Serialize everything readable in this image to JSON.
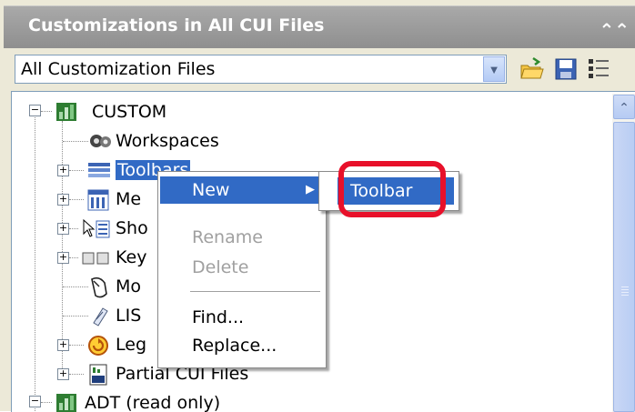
{
  "panel": {
    "title": "Customizations in All CUI Files",
    "collapse_glyph": "«"
  },
  "file_selector": {
    "value": "All Customization Files",
    "dropdown_glyph": "∨"
  },
  "toolbar_icons": [
    "open-file-icon",
    "save-icon",
    "list-view-icon"
  ],
  "tree": {
    "root": "CUSTOM",
    "items": [
      {
        "label": "Workspaces",
        "icon": "gears-icon"
      },
      {
        "label": "Toolbars",
        "icon": "toolbars-icon"
      },
      {
        "label": "Me",
        "icon": "menus-icon"
      },
      {
        "label": "Sho",
        "icon": "shortcut-menus-icon"
      },
      {
        "label": "Key",
        "icon": "keyboard-icon"
      },
      {
        "label": "Mo",
        "icon": "mouse-icon"
      },
      {
        "label": "LIS",
        "icon": "lisp-icon"
      },
      {
        "label": "Leg",
        "icon": "legacy-icon"
      },
      {
        "label": "Partial CUI Files",
        "icon": "partial-cui-icon"
      }
    ],
    "second_root": "ADT (read only)"
  },
  "context_menu": {
    "items": [
      {
        "label": "New",
        "state": "active",
        "submenu_glyph": "▶"
      },
      {
        "label": "Rename",
        "state": "disabled"
      },
      {
        "label": "Delete",
        "state": "disabled"
      },
      {
        "label": "Find...",
        "state": "normal"
      },
      {
        "label": "Replace...",
        "state": "normal"
      }
    ]
  },
  "submenu": {
    "items": [
      {
        "label": "Toolbar"
      }
    ]
  },
  "colors": {
    "selection": "#316ac5",
    "title_bar": "#999999",
    "highlight_ring": "#e8102a"
  }
}
